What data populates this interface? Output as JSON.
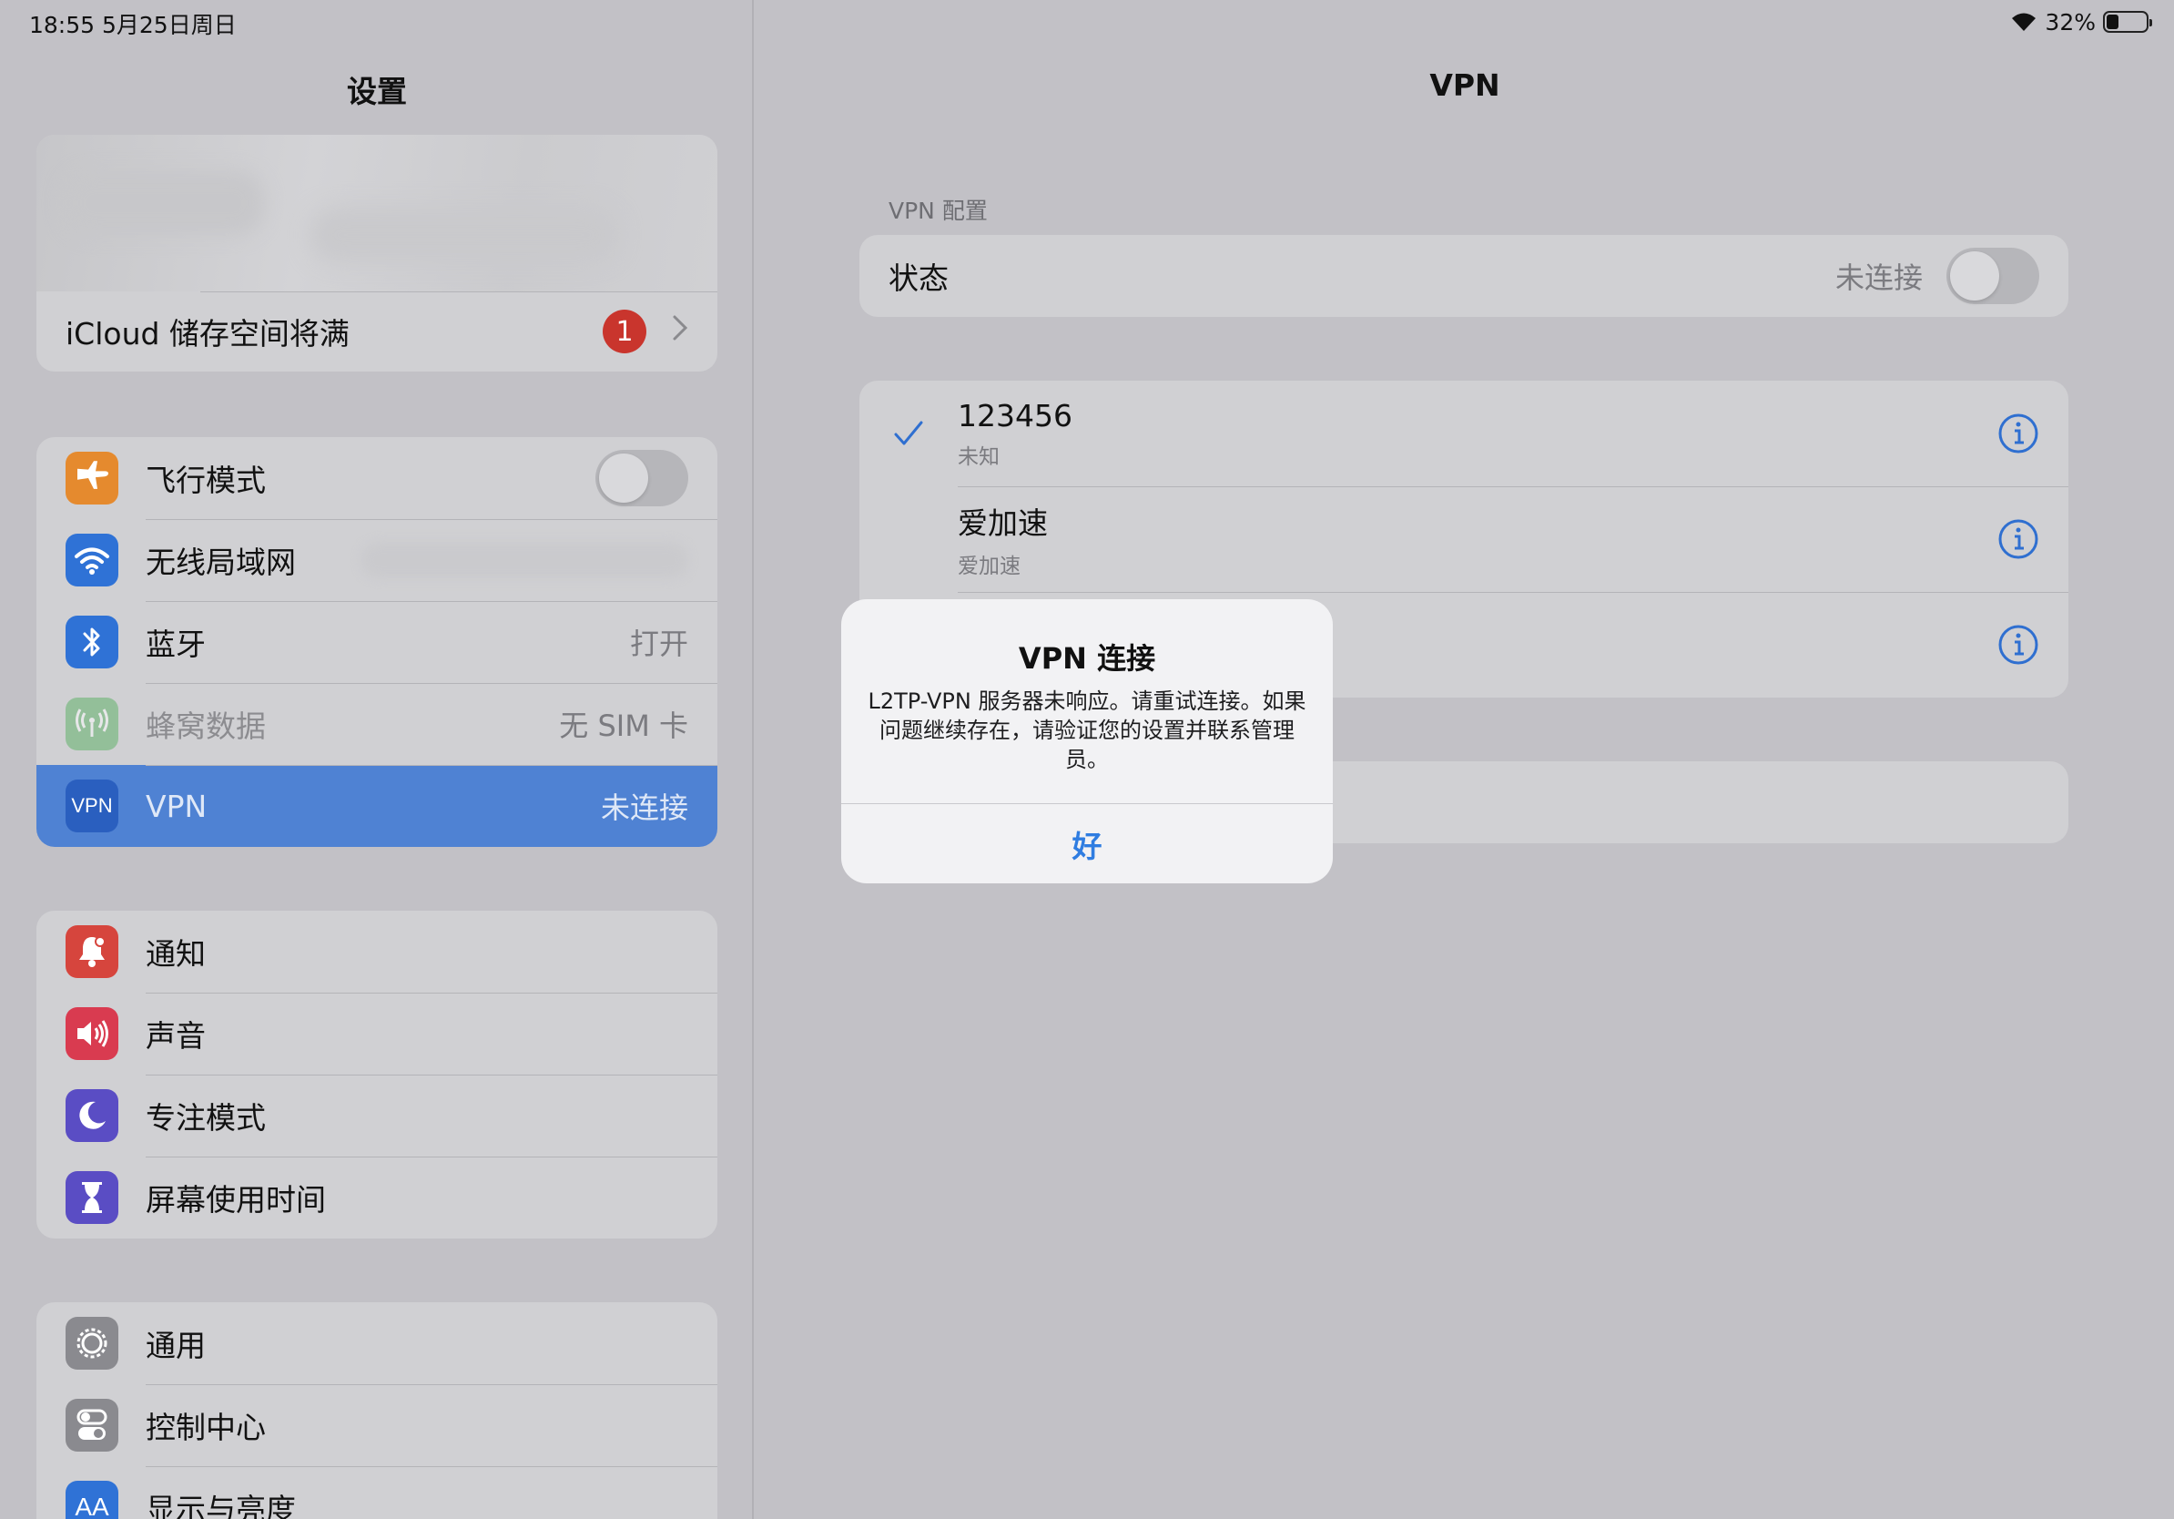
{
  "status_bar": {
    "time_date": "18:55   5月25日周日",
    "battery": "32%",
    "battery_level": 0.32
  },
  "sidebar": {
    "title": "设置",
    "icloud": {
      "label": "iCloud 储存空间将满",
      "badge": "1"
    },
    "group1": [
      {
        "label": "飞行模式",
        "icon": "airplane-icon",
        "color": "#e58a2e",
        "value": "",
        "toggle": false
      },
      {
        "label": "无线局域网",
        "icon": "wifi-icon",
        "color": "#2f72d6",
        "value": ""
      },
      {
        "label": "蓝牙",
        "icon": "bluetooth-icon",
        "color": "#2f72d6",
        "value": "打开"
      },
      {
        "label": "蜂窝数据",
        "icon": "antenna-icon",
        "color": "#58b061",
        "value": "无 SIM 卡"
      },
      {
        "label": "VPN",
        "icon": "vpn-icon",
        "color": "#2a5fbf",
        "value": "未连接"
      }
    ],
    "group2": [
      {
        "label": "通知",
        "icon": "bell-icon",
        "color": "#d6453d"
      },
      {
        "label": "声音",
        "icon": "speaker-icon",
        "color": "#d93b50"
      },
      {
        "label": "专注模式",
        "icon": "moon-icon",
        "color": "#5a4dc4"
      },
      {
        "label": "屏幕使用时间",
        "icon": "hourglass-icon",
        "color": "#5a4dc4"
      }
    ],
    "group3": [
      {
        "label": "通用",
        "icon": "gear-icon",
        "color": "#8a8a8f"
      },
      {
        "label": "控制中心",
        "icon": "switches-icon",
        "color": "#8a8a8f"
      },
      {
        "label": "显示与亮度",
        "icon": "text-size-icon",
        "color": "#2f72d6"
      }
    ]
  },
  "detail": {
    "title": "VPN",
    "section_header": "VPN 配置",
    "status_label": "状态",
    "status_value": "未连接",
    "configs": [
      {
        "name": "123456",
        "sub": "未知",
        "checked": true
      },
      {
        "name": "爱加速",
        "sub": "爱加速",
        "checked": false
      },
      {
        "name": "",
        "sub": "",
        "checked": false
      }
    ]
  },
  "alert": {
    "title": "VPN 连接",
    "message": "L2TP-VPN 服务器未响应。请重试连接。如果问题继续存在，请验证您的设置并联系管理员。",
    "ok_label": "好"
  }
}
